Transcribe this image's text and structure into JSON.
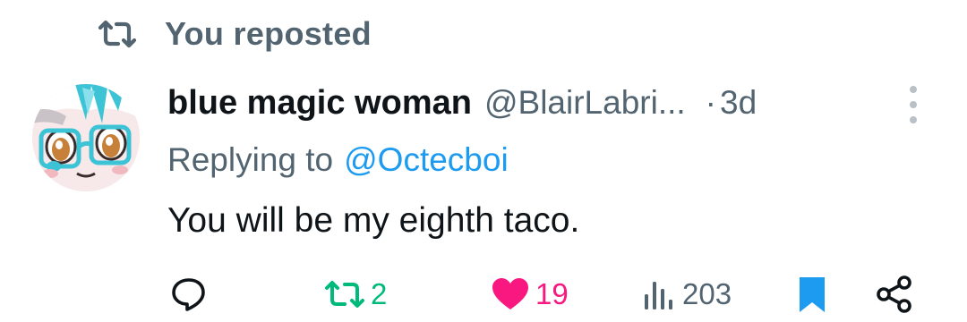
{
  "repost_header": {
    "text": "You reposted",
    "icon": "repost-icon"
  },
  "tweet": {
    "avatar_icon": "avatar",
    "display_name": "blue magic woman",
    "handle": "@BlairLabri...",
    "separator": "·",
    "time": "3d",
    "replying_prefix": "Replying to",
    "replying_to": "@Octecboi",
    "text": "You will be my eighth taco."
  },
  "actions": {
    "reply": {
      "icon": "reply-icon",
      "count": ""
    },
    "repost": {
      "icon": "repost-icon",
      "count": "2",
      "color": "#00ba7c"
    },
    "like": {
      "icon": "heart-icon",
      "count": "19",
      "color": "#f91880"
    },
    "views": {
      "icon": "views-icon",
      "count": "203"
    },
    "bookmark": {
      "icon": "bookmark-icon",
      "color": "#1d9bf0"
    },
    "share": {
      "icon": "share-icon"
    }
  },
  "colors": {
    "muted": "#536471",
    "text": "#0f1419",
    "link": "#1d9bf0"
  }
}
